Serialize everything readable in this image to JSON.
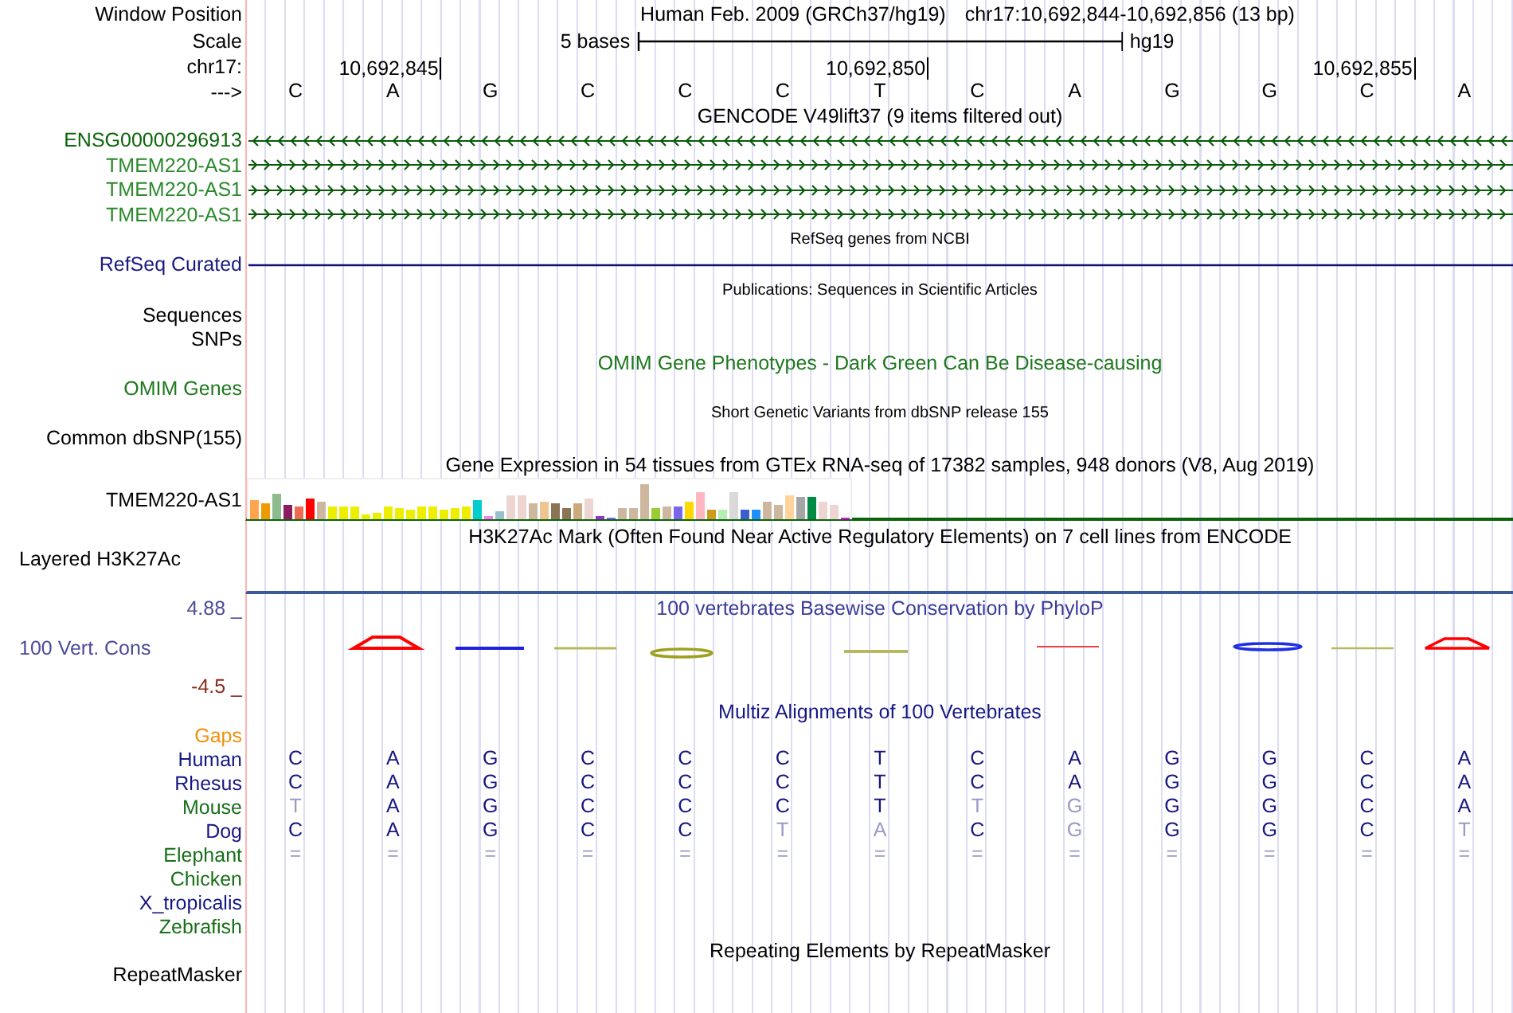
{
  "header": {
    "label": "Window Position",
    "assembly": "Human Feb. 2009 (GRCh37/hg19)",
    "position": "chr17:10,692,844-10,692,856 (13 bp)"
  },
  "scale": {
    "label": "Scale",
    "span": "5 bases",
    "assembly": "hg19"
  },
  "ruler": {
    "label": "chr17:",
    "ticks": [
      "10,692,845",
      "10,692,850",
      "10,692,855"
    ]
  },
  "sequence": {
    "label": "--->",
    "bases": [
      "C",
      "A",
      "G",
      "C",
      "C",
      "C",
      "T",
      "C",
      "A",
      "G",
      "G",
      "C",
      "A"
    ]
  },
  "gencode": {
    "title": "GENCODE V49lift37 (9 items filtered out)",
    "genes": [
      {
        "name": "ENSG00000296913",
        "kind": "reverse",
        "color": "#0b660b"
      },
      {
        "name": "TMEM220-AS1",
        "kind": "forward",
        "color": "#2a8a2a"
      },
      {
        "name": "TMEM220-AS1",
        "kind": "forward",
        "color": "#2a8a2a"
      },
      {
        "name": "TMEM220-AS1",
        "kind": "forward",
        "color": "#2a8a2a"
      }
    ]
  },
  "refseq": {
    "title": "RefSeq genes from NCBI",
    "label": "RefSeq Curated"
  },
  "publications": {
    "title": "Publications: Sequences in Scientific Articles",
    "labels": [
      "Sequences",
      "SNPs"
    ]
  },
  "omim": {
    "title": "OMIM Gene Phenotypes - Dark Green Can Be Disease-causing",
    "label": "OMIM Genes"
  },
  "dbsnp": {
    "title": "Short Genetic Variants from dbSNP release 155",
    "label": "Common dbSNP(155)"
  },
  "gtex": {
    "title": "Gene Expression in 54 tissues from GTEx RNA-seq of 17382 samples, 948 donors (V8, Aug 2019)",
    "label": "TMEM220-AS1"
  },
  "h3k27ac": {
    "title": "H3K27Ac Mark (Often Found Near Active Regulatory Elements) on 7 cell lines from ENCODE",
    "label": "Layered H3K27Ac"
  },
  "phylop": {
    "title": "100 vertebrates Basewise Conservation by PhyloP",
    "label": "100 Vert. Cons",
    "max": "4.88 _",
    "min": "-4.5 _"
  },
  "multiz": {
    "title": "Multiz Alignments of 100 Vertebrates",
    "gaps_label": "Gaps",
    "species": [
      {
        "name": "Human",
        "color": "#161682",
        "bases": [
          {
            "base": "C",
            "faded": false
          },
          {
            "base": "A",
            "faded": false
          },
          {
            "base": "G",
            "faded": false
          },
          {
            "base": "C",
            "faded": false
          },
          {
            "base": "C",
            "faded": false
          },
          {
            "base": "C",
            "faded": false
          },
          {
            "base": "T",
            "faded": false
          },
          {
            "base": "C",
            "faded": false
          },
          {
            "base": "A",
            "faded": false
          },
          {
            "base": "G",
            "faded": false
          },
          {
            "base": "G",
            "faded": false
          },
          {
            "base": "C",
            "faded": false
          },
          {
            "base": "A",
            "faded": false
          }
        ]
      },
      {
        "name": "Rhesus",
        "color": "#161682",
        "bases": [
          {
            "base": "C",
            "faded": false
          },
          {
            "base": "A",
            "faded": false
          },
          {
            "base": "G",
            "faded": false
          },
          {
            "base": "C",
            "faded": false
          },
          {
            "base": "C",
            "faded": false
          },
          {
            "base": "C",
            "faded": false
          },
          {
            "base": "T",
            "faded": false
          },
          {
            "base": "C",
            "faded": false
          },
          {
            "base": "A",
            "faded": false
          },
          {
            "base": "G",
            "faded": false
          },
          {
            "base": "G",
            "faded": false
          },
          {
            "base": "C",
            "faded": false
          },
          {
            "base": "A",
            "faded": false
          }
        ]
      },
      {
        "name": "Mouse",
        "color": "#167016",
        "bases": [
          {
            "base": "T",
            "faded": true
          },
          {
            "base": "A",
            "faded": false
          },
          {
            "base": "G",
            "faded": false
          },
          {
            "base": "C",
            "faded": false
          },
          {
            "base": "C",
            "faded": false
          },
          {
            "base": "C",
            "faded": false
          },
          {
            "base": "T",
            "faded": false
          },
          {
            "base": "T",
            "faded": true
          },
          {
            "base": "G",
            "faded": true
          },
          {
            "base": "G",
            "faded": false
          },
          {
            "base": "G",
            "faded": false
          },
          {
            "base": "C",
            "faded": false
          },
          {
            "base": "A",
            "faded": false
          }
        ]
      },
      {
        "name": "Dog",
        "color": "#161682",
        "bases": [
          {
            "base": "C",
            "faded": false
          },
          {
            "base": "A",
            "faded": false
          },
          {
            "base": "G",
            "faded": false
          },
          {
            "base": "C",
            "faded": false
          },
          {
            "base": "C",
            "faded": false
          },
          {
            "base": "T",
            "faded": true
          },
          {
            "base": "A",
            "faded": true
          },
          {
            "base": "C",
            "faded": false
          },
          {
            "base": "G",
            "faded": true
          },
          {
            "base": "G",
            "faded": false
          },
          {
            "base": "G",
            "faded": false
          },
          {
            "base": "C",
            "faded": false
          },
          {
            "base": "T",
            "faded": true
          }
        ]
      },
      {
        "name": "Elephant",
        "color": "#167016",
        "bases": [
          {
            "base": "=",
            "faded": true
          },
          {
            "base": "=",
            "faded": true
          },
          {
            "base": "=",
            "faded": true
          },
          {
            "base": "=",
            "faded": true
          },
          {
            "base": "=",
            "faded": true
          },
          {
            "base": "=",
            "faded": true
          },
          {
            "base": "=",
            "faded": true
          },
          {
            "base": "=",
            "faded": true
          },
          {
            "base": "=",
            "faded": true
          },
          {
            "base": "=",
            "faded": true
          },
          {
            "base": "=",
            "faded": true
          },
          {
            "base": "=",
            "faded": true
          },
          {
            "base": "=",
            "faded": true
          }
        ]
      },
      {
        "name": "Chicken",
        "color": "#167016"
      },
      {
        "name": "X_tropicalis",
        "color": "#161682"
      },
      {
        "name": "Zebrafish",
        "color": "#167016"
      }
    ]
  },
  "repeatmasker": {
    "title": "Repeating Elements by RepeatMasker",
    "label": "RepeatMasker"
  }
}
